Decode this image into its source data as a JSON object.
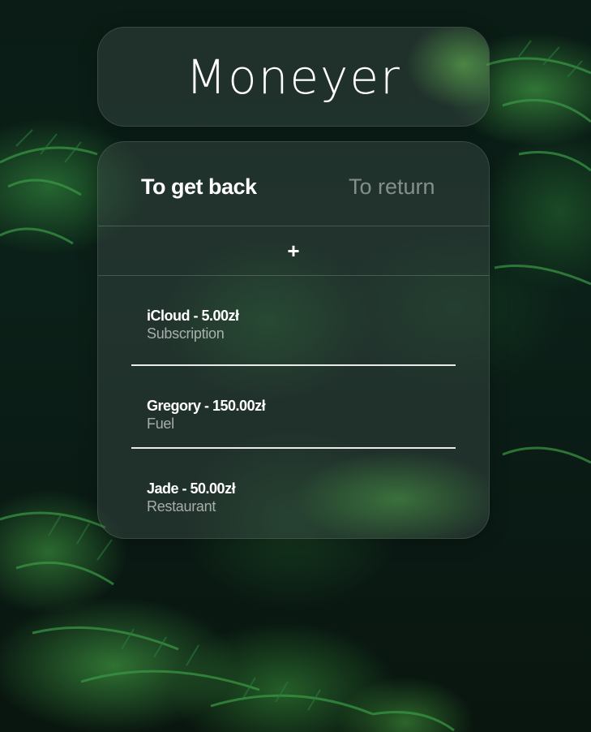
{
  "app": {
    "title": "Moneyer"
  },
  "tabs": [
    {
      "label": "To get back",
      "active": true
    },
    {
      "label": "To return",
      "active": false
    }
  ],
  "add_button": {
    "icon": "plus-icon",
    "glyph": "+"
  },
  "entries": [
    {
      "title": "iCloud - 5.00zł",
      "category": "Subscription"
    },
    {
      "title": "Gregory - 150.00zł",
      "category": "Fuel"
    },
    {
      "title": "Jade - 50.00zł",
      "category": "Restaurant"
    }
  ],
  "colors": {
    "text_primary": "#ffffff",
    "text_muted": "#9aa39f",
    "card_glass": "#3c4b46"
  }
}
